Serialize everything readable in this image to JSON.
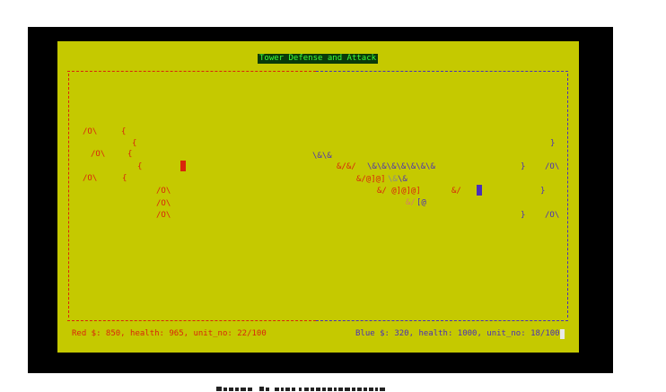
{
  "window": {
    "title": "Tower Defense and Attack"
  },
  "colors": {
    "background": "#c5c900",
    "frame": "#000000",
    "red_team": "#d9250b",
    "blue_team": "#4a2fb8",
    "title_text": "#3cff3c"
  },
  "board": {
    "red_left": [
      "/O\\",
      "/O\\",
      "/O\\"
    ],
    "red_middle": [
      "/O\\",
      "/O\\",
      "/O\\"
    ],
    "brace_left": "{",
    "brace_right": "}",
    "blue_right": [
      "/O\\",
      "/O\\"
    ],
    "clash_rows": [
      "\\&\\&",
      "&/&/",
      "\\&\\&\\&\\&\\&\\&\\&",
      "&/@]@]",
      "\\&",
      "\\&",
      "&/ @]@]@]",
      "&/",
      "&/",
      "[@"
    ]
  },
  "status": {
    "red": "Red $: 850, health: 965, unit_no: 22/100",
    "blue": "Blue $: 320, health: 1000, unit_no: 18/100"
  }
}
